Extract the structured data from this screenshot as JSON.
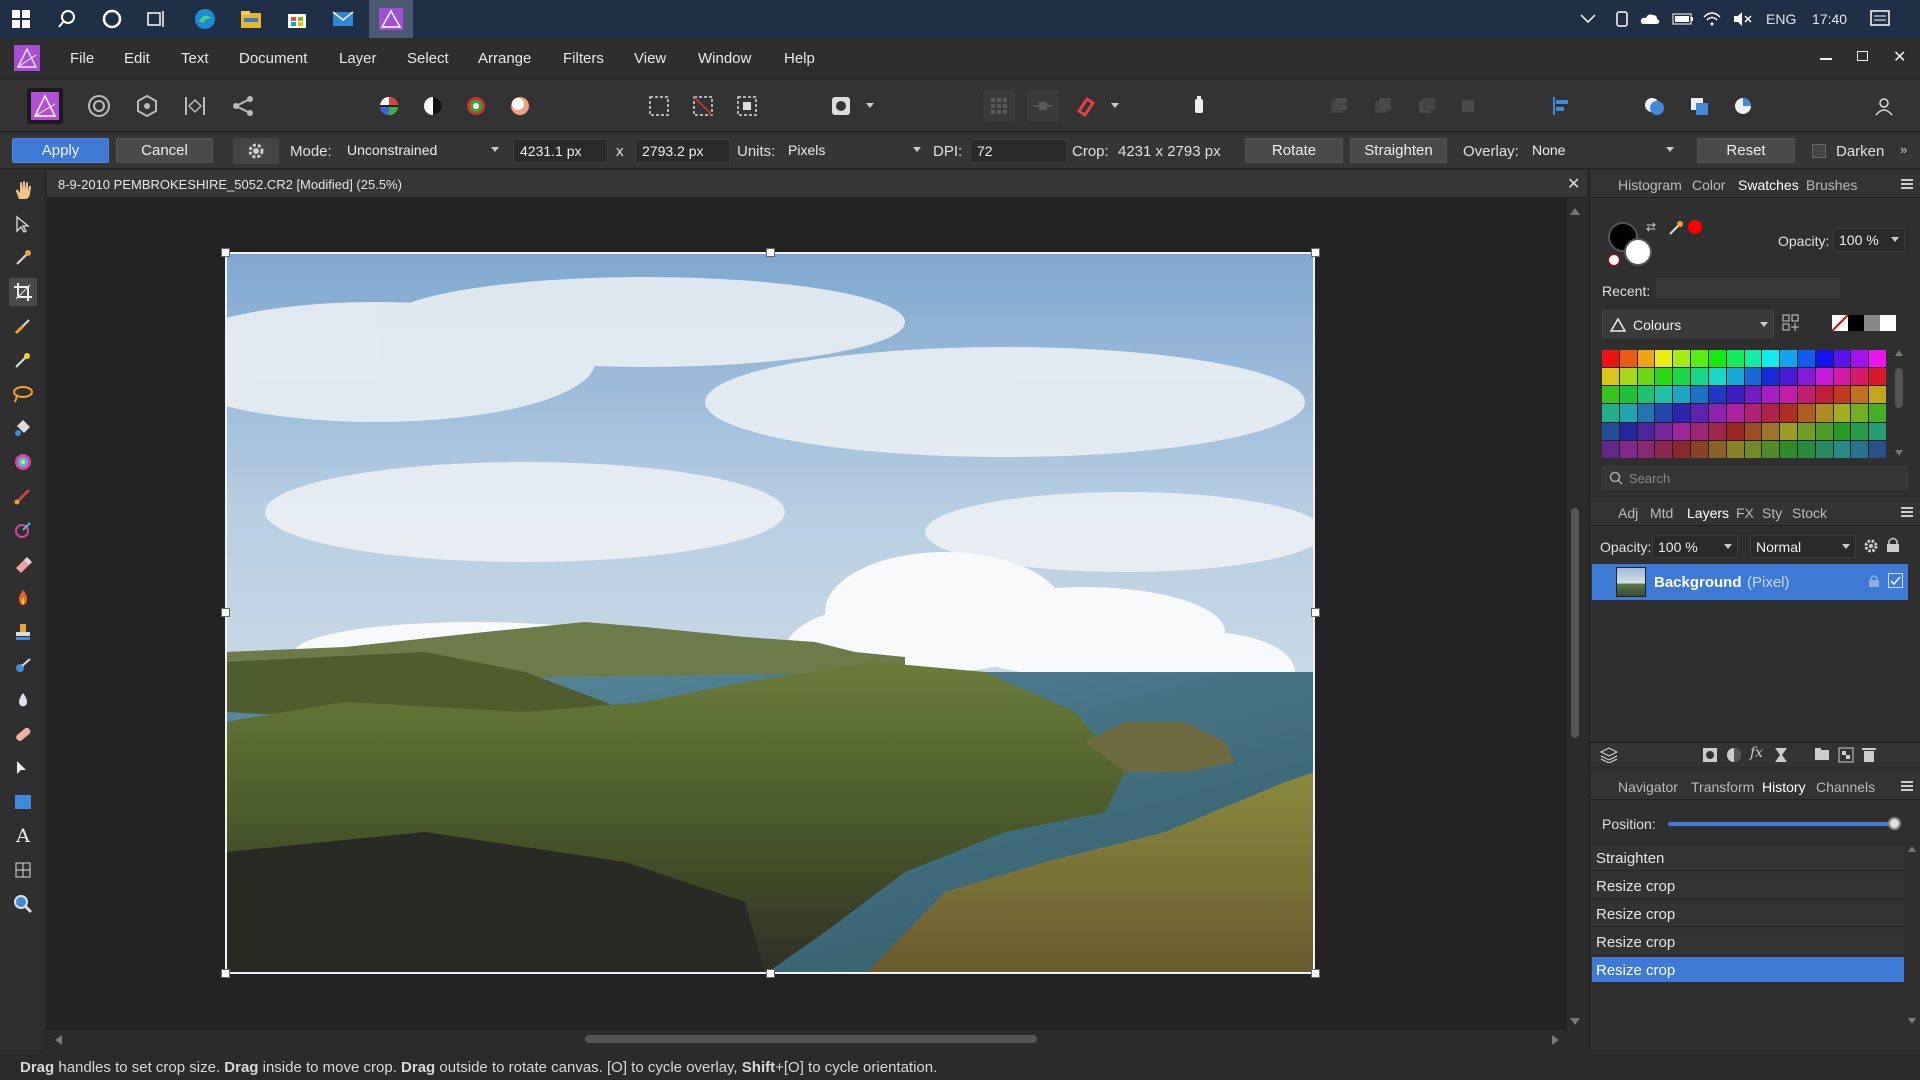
{
  "taskbar": {
    "clock": "17:40",
    "language": "ENG"
  },
  "menu": {
    "items": [
      "File",
      "Edit",
      "Text",
      "Document",
      "Layer",
      "Select",
      "Arrange",
      "Filters",
      "View",
      "Window",
      "Help"
    ]
  },
  "context": {
    "apply": "Apply",
    "cancel": "Cancel",
    "mode_label": "Mode:",
    "mode_value": "Unconstrained",
    "width": "4231.1 px",
    "times": "x",
    "height": "2793.2 px",
    "units_label": "Units:",
    "units_value": "Pixels",
    "dpi_label": "DPI:",
    "dpi_value": "72",
    "crop_label": "Crop:",
    "crop_value": "4231 x 2793 px",
    "rotate": "Rotate",
    "straighten": "Straighten",
    "overlay_label": "Overlay:",
    "overlay_value": "None",
    "reset": "Reset",
    "darken": "Darken"
  },
  "document": {
    "title": "8-9-2010 PEMBROKESHIRE_5052.CR2 [Modified] (25.5%)"
  },
  "panel_top": {
    "tabs": [
      "Histogram",
      "Color",
      "Swatches",
      "Brushes"
    ],
    "active_tab": "Swatches",
    "opacity_label": "Opacity:",
    "opacity_value": "100 %",
    "recent_label": "Recent:",
    "palette": "Colours",
    "search_placeholder": "Search"
  },
  "panel_layers": {
    "tabs": [
      "Adj",
      "Mtd",
      "Layers",
      "FX",
      "Sty",
      "Stock"
    ],
    "active_tab": "Layers",
    "opacity_label": "Opacity:",
    "opacity_value": "100 %",
    "blend_mode": "Normal",
    "layer_name": "Background",
    "layer_type": "(Pixel)"
  },
  "panel_history": {
    "tabs": [
      "Navigator",
      "Transform",
      "History",
      "Channels"
    ],
    "active_tab": "History",
    "position_label": "Position:",
    "position_value": 1.0,
    "items": [
      "Straighten",
      "Resize crop",
      "Resize crop",
      "Resize crop",
      "Resize crop"
    ],
    "selected_index": 4
  },
  "status": {
    "b1": "Drag",
    "t1": " handles to set crop size. ",
    "b2": "Drag",
    "t2": " inside to move crop. ",
    "b3": "Drag",
    "t3": " outside to rotate canvas. [O] to cycle overlay, ",
    "b4": "Shift",
    "t4": "+[O] to cycle orientation."
  },
  "colors": {
    "accent": "#3e79d6",
    "primary_fill": "#000000",
    "secondary_fill": "#ffffff",
    "recent_swatch": "#ff0000"
  }
}
